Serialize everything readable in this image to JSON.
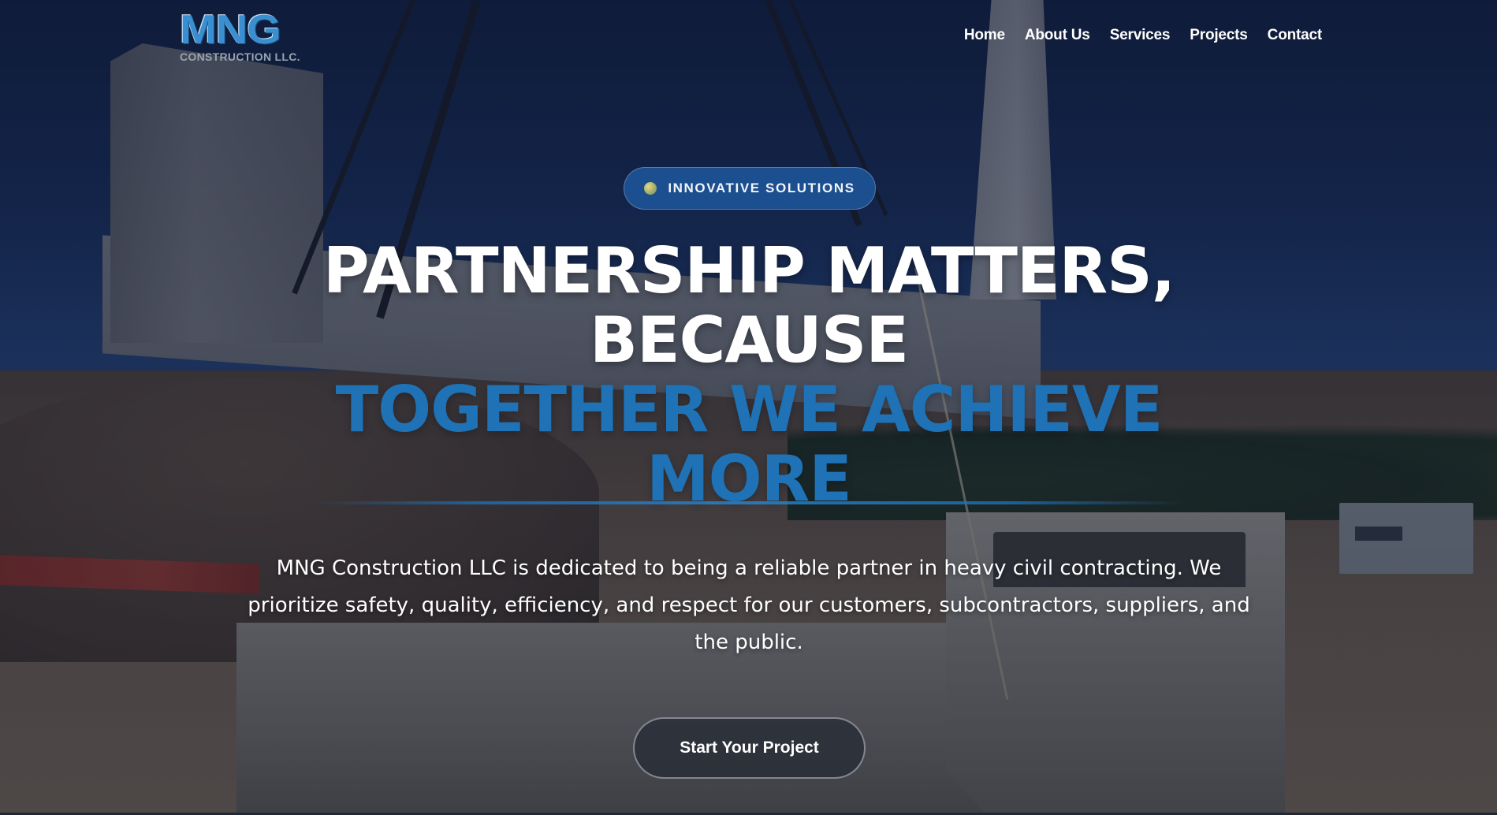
{
  "brand": {
    "logo_mark": "MNG",
    "logo_subtitle": "CONSTRUCTION LLC."
  },
  "nav": {
    "items": [
      {
        "label": "Home"
      },
      {
        "label": "About Us"
      },
      {
        "label": "Services"
      },
      {
        "label": "Projects"
      },
      {
        "label": "Contact"
      }
    ]
  },
  "hero": {
    "badge": "INNOVATIVE SOLUTIONS",
    "headline_line1": "PARTNERSHIP MATTERS,",
    "headline_line2": "BECAUSE",
    "headline_highlight_line1": "TOGETHER WE ACHIEVE",
    "headline_highlight_line2": "MORE",
    "description": "MNG Construction LLC is dedicated to being a reliable partner in heavy civil contracting. We prioritize safety, quality, efficiency, and respect for our customers, subcontractors, suppliers, and the public.",
    "cta_label": "Start Your Project"
  },
  "colors": {
    "accent_blue": "#1e72b5",
    "badge_bg": "#1c4f8f",
    "text": "#ffffff"
  }
}
